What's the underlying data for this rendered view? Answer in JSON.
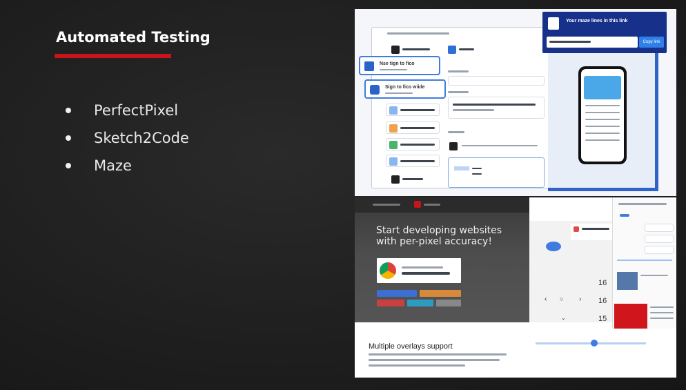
{
  "slide": {
    "title": "Automated Testing",
    "accent_color": "#c8141a",
    "bullets": [
      {
        "label": "PerfectPixel"
      },
      {
        "label": "Sketch2Code"
      },
      {
        "label": "Maze"
      }
    ]
  },
  "screenshot_top": {
    "card_1_label": "Nse tign to fico",
    "card_2_label": "Sign to fico wiide",
    "popup_title": "Your maze lines in this link",
    "popup_button": "Copy link"
  },
  "screenshot_bottom": {
    "hero_title": "Start developing websites with per-pixel accuracy!",
    "footer_heading": "Multiple overlays support",
    "number_values": [
      "16",
      "16",
      "15"
    ]
  }
}
